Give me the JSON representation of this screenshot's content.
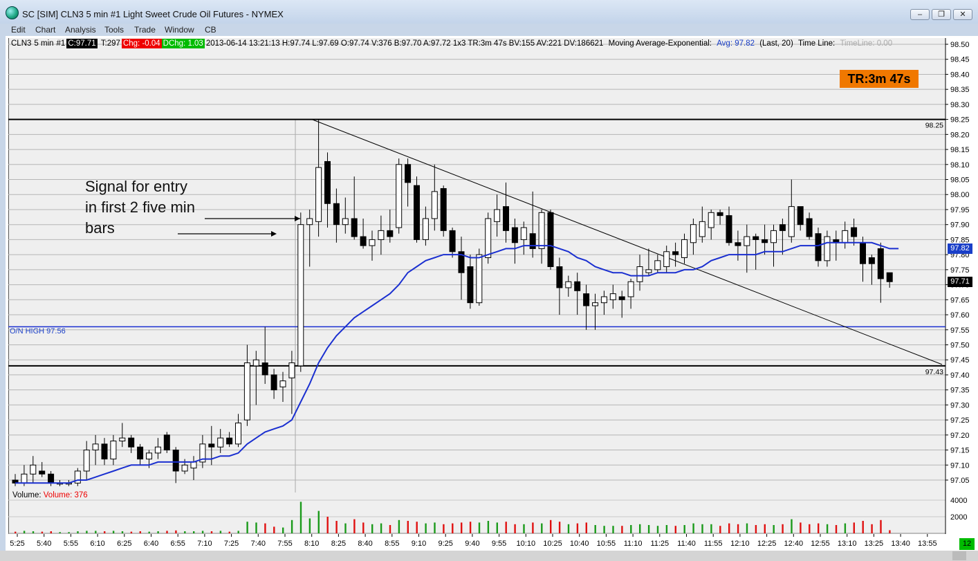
{
  "window": {
    "title": "SC [SIM] CLN3  5 min  #1  Light Sweet Crude Oil Futures - NYMEX",
    "minimize_label": "–",
    "maximize_label": "❐",
    "close_label": "✕"
  },
  "menu": [
    "Edit",
    "Chart",
    "Analysis",
    "Tools",
    "Trade",
    "Window",
    "CB"
  ],
  "infobar": {
    "symbol": "CLN3",
    "interval": "5 min",
    "chart_num": "#1",
    "close": "C:97.71",
    "ticks": "T:297",
    "change": "Chg: -0.04",
    "daily_change": "DChg: 1.03",
    "details": "2013-06-14 13:21:13 H:97.74 L:97.69 O:97.74 V:376 B:97.70 A:97.72 1x3 TR:3m 47s BV:155 AV:221 DV:186621",
    "study": "Moving Average-Exponential:",
    "avg": "Avg: 97.82",
    "params": "(Last, 20)",
    "timeline": "Time Line:",
    "timeline_value": "TimeLine: 0.00"
  },
  "timer_box": "TR:3m 47s",
  "annotation": {
    "lines": [
      "Signal for entry",
      "in first 2 five min",
      "bars"
    ]
  },
  "volume_label": "Volume:",
  "volume_value": "Volume: 376",
  "levels": {
    "top_line_label": "98.25",
    "bottom_line_label": "97.43",
    "on_high_label": "O/N  HIGH  97.56"
  },
  "price_tags": {
    "ema": "97.82",
    "last": "97.71"
  },
  "price_axis": [
    "98.50",
    "98.45",
    "98.40",
    "98.35",
    "98.30",
    "98.25",
    "98.20",
    "98.15",
    "98.10",
    "98.05",
    "98.00",
    "97.95",
    "97.90",
    "97.85",
    "97.80",
    "97.75",
    "97.70",
    "97.65",
    "97.60",
    "97.55",
    "97.50",
    "97.45",
    "97.40",
    "97.35",
    "97.30",
    "97.25",
    "97.20",
    "97.15",
    "97.10",
    "97.05"
  ],
  "volume_axis": [
    "4000",
    "2000"
  ],
  "time_axis": [
    "5:25",
    "5:40",
    "5:55",
    "6:10",
    "6:25",
    "6:40",
    "6:55",
    "7:10",
    "7:25",
    "7:40",
    "7:55",
    "8:10",
    "8:25",
    "8:40",
    "8:55",
    "9:10",
    "9:25",
    "9:40",
    "9:55",
    "10:10",
    "10:25",
    "10:40",
    "10:55",
    "11:10",
    "11:25",
    "11:40",
    "11:55",
    "12:10",
    "12:25",
    "12:40",
    "12:55",
    "13:10",
    "13:25",
    "13:40",
    "13:55"
  ],
  "bar_counter": "12",
  "colors": {
    "ema_line": "#1a2fd0",
    "on_high_line": "#1a2fd0",
    "vol_up": "#1a9a1a",
    "vol_down": "#e01010",
    "timer_box": "#f07800"
  },
  "chart_data": {
    "type": "candlestick",
    "y_range": [
      97.0,
      98.5
    ],
    "bars": [
      {
        "t": "5:20",
        "o": 97.05,
        "h": 97.07,
        "l": 97.03,
        "c": 97.04,
        "v": 200
      },
      {
        "t": "5:25",
        "o": 97.04,
        "h": 97.1,
        "l": 97.03,
        "c": 97.07,
        "v": 300
      },
      {
        "t": "5:30",
        "o": 97.07,
        "h": 97.13,
        "l": 97.04,
        "c": 97.1,
        "v": 250
      },
      {
        "t": "5:35",
        "o": 97.08,
        "h": 97.11,
        "l": 97.06,
        "c": 97.07,
        "v": 200
      },
      {
        "t": "5:40",
        "o": 97.07,
        "h": 97.08,
        "l": 97.03,
        "c": 97.04,
        "v": 250
      },
      {
        "t": "5:45",
        "o": 97.04,
        "h": 97.05,
        "l": 97.03,
        "c": 97.04,
        "v": 150
      },
      {
        "t": "5:50",
        "o": 97.04,
        "h": 97.05,
        "l": 97.03,
        "c": 97.04,
        "v": 150
      },
      {
        "t": "5:55",
        "o": 97.04,
        "h": 97.09,
        "l": 97.03,
        "c": 97.08,
        "v": 250
      },
      {
        "t": "6:00",
        "o": 97.08,
        "h": 97.18,
        "l": 97.05,
        "c": 97.15,
        "v": 300
      },
      {
        "t": "6:05",
        "o": 97.15,
        "h": 97.2,
        "l": 97.1,
        "c": 97.17,
        "v": 300
      },
      {
        "t": "6:10",
        "o": 97.17,
        "h": 97.19,
        "l": 97.1,
        "c": 97.12,
        "v": 250
      },
      {
        "t": "6:15",
        "o": 97.12,
        "h": 97.2,
        "l": 97.1,
        "c": 97.18,
        "v": 300
      },
      {
        "t": "6:20",
        "o": 97.18,
        "h": 97.24,
        "l": 97.16,
        "c": 97.19,
        "v": 250
      },
      {
        "t": "6:25",
        "o": 97.19,
        "h": 97.2,
        "l": 97.14,
        "c": 97.16,
        "v": 200
      },
      {
        "t": "6:30",
        "o": 97.16,
        "h": 97.17,
        "l": 97.1,
        "c": 97.12,
        "v": 250
      },
      {
        "t": "6:35",
        "o": 97.12,
        "h": 97.15,
        "l": 97.09,
        "c": 97.14,
        "v": 200
      },
      {
        "t": "6:40",
        "o": 97.14,
        "h": 97.19,
        "l": 97.12,
        "c": 97.16,
        "v": 250
      },
      {
        "t": "6:45",
        "o": 97.2,
        "h": 97.21,
        "l": 97.14,
        "c": 97.15,
        "v": 300
      },
      {
        "t": "6:50",
        "o": 97.15,
        "h": 97.16,
        "l": 97.04,
        "c": 97.08,
        "v": 350
      },
      {
        "t": "6:55",
        "o": 97.08,
        "h": 97.12,
        "l": 97.07,
        "c": 97.1,
        "v": 250
      },
      {
        "t": "7:00",
        "o": 97.09,
        "h": 97.13,
        "l": 97.05,
        "c": 97.11,
        "v": 250
      },
      {
        "t": "7:05",
        "o": 97.11,
        "h": 97.2,
        "l": 97.09,
        "c": 97.17,
        "v": 300
      },
      {
        "t": "7:10",
        "o": 97.17,
        "h": 97.23,
        "l": 97.1,
        "c": 97.16,
        "v": 250
      },
      {
        "t": "7:15",
        "o": 97.16,
        "h": 97.22,
        "l": 97.14,
        "c": 97.19,
        "v": 300
      },
      {
        "t": "7:20",
        "o": 97.19,
        "h": 97.21,
        "l": 97.16,
        "c": 97.17,
        "v": 200
      },
      {
        "t": "7:25",
        "o": 97.17,
        "h": 97.27,
        "l": 97.16,
        "c": 97.24,
        "v": 300
      },
      {
        "t": "7:30",
        "o": 97.25,
        "h": 97.5,
        "l": 97.23,
        "c": 97.44,
        "v": 1400
      },
      {
        "t": "7:35",
        "o": 97.43,
        "h": 97.48,
        "l": 97.3,
        "c": 97.45,
        "v": 1300
      },
      {
        "t": "7:40",
        "o": 97.44,
        "h": 97.56,
        "l": 97.37,
        "c": 97.4,
        "v": 1200
      },
      {
        "t": "7:45",
        "o": 97.4,
        "h": 97.42,
        "l": 97.32,
        "c": 97.35,
        "v": 800
      },
      {
        "t": "7:50",
        "o": 97.36,
        "h": 97.41,
        "l": 97.31,
        "c": 97.38,
        "v": 700
      },
      {
        "t": "7:55",
        "o": 97.39,
        "h": 97.48,
        "l": 97.27,
        "c": 97.44,
        "v": 1600
      },
      {
        "t": "8:00",
        "o": 97.43,
        "h": 97.94,
        "l": 97.41,
        "c": 97.9,
        "v": 3800
      },
      {
        "t": "8:05",
        "o": 97.9,
        "h": 97.95,
        "l": 97.76,
        "c": 97.92,
        "v": 1800
      },
      {
        "t": "8:10",
        "o": 97.91,
        "h": 98.25,
        "l": 97.86,
        "c": 98.09,
        "v": 2700
      },
      {
        "t": "8:15",
        "o": 98.11,
        "h": 98.14,
        "l": 97.89,
        "c": 97.97,
        "v": 2000
      },
      {
        "t": "8:20",
        "o": 97.97,
        "h": 98.02,
        "l": 97.84,
        "c": 97.9,
        "v": 1500
      },
      {
        "t": "8:25",
        "o": 97.9,
        "h": 97.99,
        "l": 97.87,
        "c": 97.92,
        "v": 1200
      },
      {
        "t": "8:30",
        "o": 97.92,
        "h": 98.06,
        "l": 97.85,
        "c": 97.86,
        "v": 1700
      },
      {
        "t": "8:35",
        "o": 97.86,
        "h": 97.92,
        "l": 97.82,
        "c": 97.83,
        "v": 1300
      },
      {
        "t": "8:40",
        "o": 97.83,
        "h": 97.88,
        "l": 97.78,
        "c": 97.85,
        "v": 1100
      },
      {
        "t": "8:45",
        "o": 97.85,
        "h": 97.93,
        "l": 97.8,
        "c": 97.88,
        "v": 1200
      },
      {
        "t": "8:50",
        "o": 97.88,
        "h": 97.95,
        "l": 97.84,
        "c": 97.86,
        "v": 1000
      },
      {
        "t": "8:55",
        "o": 97.89,
        "h": 98.12,
        "l": 97.87,
        "c": 98.1,
        "v": 1600
      },
      {
        "t": "9:00",
        "o": 98.1,
        "h": 98.12,
        "l": 97.96,
        "c": 98.04,
        "v": 1500
      },
      {
        "t": "9:05",
        "o": 98.03,
        "h": 98.06,
        "l": 97.84,
        "c": 97.85,
        "v": 1400
      },
      {
        "t": "9:10",
        "o": 97.85,
        "h": 97.96,
        "l": 97.83,
        "c": 97.92,
        "v": 1200
      },
      {
        "t": "9:15",
        "o": 97.92,
        "h": 98.1,
        "l": 97.88,
        "c": 98.01,
        "v": 1300
      },
      {
        "t": "9:20",
        "o": 98.02,
        "h": 98.03,
        "l": 97.86,
        "c": 97.88,
        "v": 1100
      },
      {
        "t": "9:25",
        "o": 97.88,
        "h": 97.89,
        "l": 97.79,
        "c": 97.81,
        "v": 1200
      },
      {
        "t": "9:30",
        "o": 97.81,
        "h": 97.86,
        "l": 97.65,
        "c": 97.74,
        "v": 1300
      },
      {
        "t": "9:35",
        "o": 97.76,
        "h": 97.8,
        "l": 97.62,
        "c": 97.64,
        "v": 1400
      },
      {
        "t": "9:40",
        "o": 97.64,
        "h": 97.82,
        "l": 97.63,
        "c": 97.8,
        "v": 1300
      },
      {
        "t": "9:45",
        "o": 97.79,
        "h": 97.94,
        "l": 97.77,
        "c": 97.92,
        "v": 1500
      },
      {
        "t": "9:50",
        "o": 97.91,
        "h": 98.0,
        "l": 97.86,
        "c": 97.95,
        "v": 1300
      },
      {
        "t": "9:55",
        "o": 97.96,
        "h": 98.04,
        "l": 97.84,
        "c": 97.88,
        "v": 1400
      },
      {
        "t": "10:00",
        "o": 97.89,
        "h": 97.92,
        "l": 97.77,
        "c": 97.84,
        "v": 1100
      },
      {
        "t": "10:05",
        "o": 97.85,
        "h": 97.91,
        "l": 97.8,
        "c": 97.89,
        "v": 1100
      },
      {
        "t": "10:10",
        "o": 97.87,
        "h": 98.01,
        "l": 97.79,
        "c": 97.82,
        "v": 1300
      },
      {
        "t": "10:15",
        "o": 97.82,
        "h": 97.95,
        "l": 97.77,
        "c": 97.94,
        "v": 1200
      },
      {
        "t": "10:20",
        "o": 97.94,
        "h": 97.95,
        "l": 97.75,
        "c": 97.76,
        "v": 1600
      },
      {
        "t": "10:25",
        "o": 97.76,
        "h": 97.79,
        "l": 97.6,
        "c": 97.69,
        "v": 1400
      },
      {
        "t": "10:30",
        "o": 97.69,
        "h": 97.73,
        "l": 97.66,
        "c": 97.71,
        "v": 1100
      },
      {
        "t": "10:35",
        "o": 97.71,
        "h": 97.74,
        "l": 97.6,
        "c": 97.68,
        "v": 1200
      },
      {
        "t": "10:40",
        "o": 97.67,
        "h": 97.7,
        "l": 97.55,
        "c": 97.63,
        "v": 1300
      },
      {
        "t": "10:45",
        "o": 97.63,
        "h": 97.67,
        "l": 97.55,
        "c": 97.64,
        "v": 1000
      },
      {
        "t": "10:50",
        "o": 97.64,
        "h": 97.68,
        "l": 97.6,
        "c": 97.66,
        "v": 900
      },
      {
        "t": "10:55",
        "o": 97.65,
        "h": 97.7,
        "l": 97.62,
        "c": 97.67,
        "v": 900
      },
      {
        "t": "11:00",
        "o": 97.66,
        "h": 97.68,
        "l": 97.59,
        "c": 97.65,
        "v": 900
      },
      {
        "t": "11:05",
        "o": 97.66,
        "h": 97.72,
        "l": 97.62,
        "c": 97.71,
        "v": 1000
      },
      {
        "t": "11:10",
        "o": 97.71,
        "h": 97.8,
        "l": 97.68,
        "c": 97.76,
        "v": 1100
      },
      {
        "t": "11:15",
        "o": 97.74,
        "h": 97.82,
        "l": 97.73,
        "c": 97.75,
        "v": 1000
      },
      {
        "t": "11:20",
        "o": 97.75,
        "h": 97.8,
        "l": 97.74,
        "c": 97.78,
        "v": 900
      },
      {
        "t": "11:25",
        "o": 97.76,
        "h": 97.83,
        "l": 97.74,
        "c": 97.81,
        "v": 1000
      },
      {
        "t": "11:30",
        "o": 97.81,
        "h": 97.84,
        "l": 97.76,
        "c": 97.8,
        "v": 900
      },
      {
        "t": "11:35",
        "o": 97.79,
        "h": 97.87,
        "l": 97.77,
        "c": 97.85,
        "v": 1000
      },
      {
        "t": "11:40",
        "o": 97.84,
        "h": 97.92,
        "l": 97.8,
        "c": 97.9,
        "v": 1200
      },
      {
        "t": "11:45",
        "o": 97.86,
        "h": 97.96,
        "l": 97.84,
        "c": 97.91,
        "v": 1100
      },
      {
        "t": "11:50",
        "o": 97.89,
        "h": 97.95,
        "l": 97.85,
        "c": 97.94,
        "v": 1100
      },
      {
        "t": "11:55",
        "o": 97.94,
        "h": 97.95,
        "l": 97.9,
        "c": 97.93,
        "v": 900
      },
      {
        "t": "12:00",
        "o": 97.93,
        "h": 97.96,
        "l": 97.83,
        "c": 97.84,
        "v": 1200
      },
      {
        "t": "12:05",
        "o": 97.84,
        "h": 97.88,
        "l": 97.78,
        "c": 97.83,
        "v": 1100
      },
      {
        "t": "12:10",
        "o": 97.83,
        "h": 97.9,
        "l": 97.74,
        "c": 97.86,
        "v": 1200
      },
      {
        "t": "12:15",
        "o": 97.86,
        "h": 97.87,
        "l": 97.75,
        "c": 97.85,
        "v": 1000
      },
      {
        "t": "12:20",
        "o": 97.85,
        "h": 97.9,
        "l": 97.8,
        "c": 97.84,
        "v": 1100
      },
      {
        "t": "12:25",
        "o": 97.84,
        "h": 97.9,
        "l": 97.76,
        "c": 97.88,
        "v": 1000
      },
      {
        "t": "12:30",
        "o": 97.9,
        "h": 97.92,
        "l": 97.8,
        "c": 97.88,
        "v": 1100
      },
      {
        "t": "12:35",
        "o": 97.86,
        "h": 98.05,
        "l": 97.84,
        "c": 97.96,
        "v": 1700
      },
      {
        "t": "12:40",
        "o": 97.96,
        "h": 97.96,
        "l": 97.88,
        "c": 97.9,
        "v": 1300
      },
      {
        "t": "12:45",
        "o": 97.92,
        "h": 97.94,
        "l": 97.85,
        "c": 97.86,
        "v": 1100
      },
      {
        "t": "12:50",
        "o": 97.87,
        "h": 97.89,
        "l": 97.76,
        "c": 97.78,
        "v": 1200
      },
      {
        "t": "12:55",
        "o": 97.78,
        "h": 97.88,
        "l": 97.76,
        "c": 97.86,
        "v": 1100
      },
      {
        "t": "13:00",
        "o": 97.85,
        "h": 97.88,
        "l": 97.78,
        "c": 97.84,
        "v": 1000
      },
      {
        "t": "13:05",
        "o": 97.84,
        "h": 97.91,
        "l": 97.82,
        "c": 97.88,
        "v": 1200
      },
      {
        "t": "13:10",
        "o": 97.89,
        "h": 97.92,
        "l": 97.83,
        "c": 97.86,
        "v": 1300
      },
      {
        "t": "13:15",
        "o": 97.84,
        "h": 97.86,
        "l": 97.71,
        "c": 97.77,
        "v": 1500
      },
      {
        "t": "13:20",
        "o": 97.79,
        "h": 97.8,
        "l": 97.7,
        "c": 97.77,
        "v": 1100
      },
      {
        "t": "13:25",
        "o": 97.82,
        "h": 97.84,
        "l": 97.64,
        "c": 97.72,
        "v": 1600
      },
      {
        "t": "13:30",
        "o": 97.74,
        "h": 97.74,
        "l": 97.69,
        "c": 97.71,
        "v": 376
      }
    ],
    "ema_values": [
      97.04,
      97.04,
      97.04,
      97.04,
      97.04,
      97.04,
      97.04,
      97.05,
      97.05,
      97.06,
      97.07,
      97.08,
      97.09,
      97.1,
      97.1,
      97.1,
      97.11,
      97.11,
      97.11,
      97.11,
      97.11,
      97.12,
      97.12,
      97.13,
      97.13,
      97.14,
      97.17,
      97.19,
      97.21,
      97.22,
      97.23,
      97.25,
      97.31,
      97.37,
      97.44,
      97.49,
      97.53,
      97.56,
      97.59,
      97.61,
      97.63,
      97.65,
      97.67,
      97.7,
      97.74,
      97.76,
      97.78,
      97.79,
      97.8,
      97.8,
      97.8,
      97.79,
      97.79,
      97.8,
      97.81,
      97.82,
      97.82,
      97.83,
      97.83,
      97.83,
      97.83,
      97.82,
      97.81,
      97.79,
      97.78,
      97.76,
      97.75,
      97.74,
      97.74,
      97.73,
      97.73,
      97.73,
      97.74,
      97.74,
      97.74,
      97.75,
      97.75,
      97.76,
      97.78,
      97.79,
      97.8,
      97.8,
      97.8,
      97.8,
      97.81,
      97.81,
      97.81,
      97.82,
      97.83,
      97.83,
      97.83,
      97.84,
      97.84,
      97.84,
      97.84,
      97.84,
      97.84,
      97.83,
      97.82,
      97.82
    ]
  }
}
